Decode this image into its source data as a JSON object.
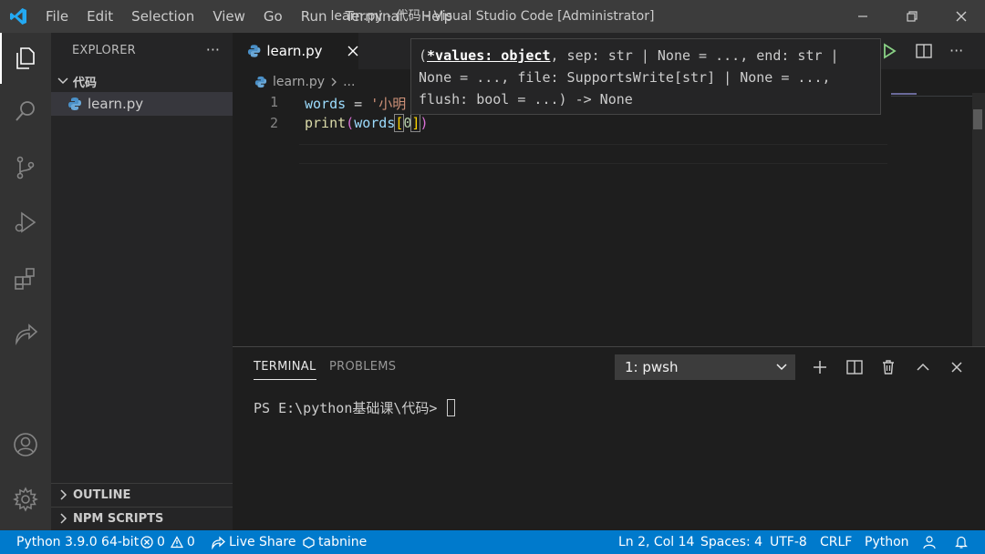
{
  "titlebar": {
    "menus": [
      "File",
      "Edit",
      "Selection",
      "View",
      "Go",
      "Run",
      "Terminal",
      "Help"
    ],
    "title": "learn.py - 代码 - Visual Studio Code [Administrator]"
  },
  "sidebar": {
    "header": "EXPLORER",
    "more": "···",
    "folder": "代码",
    "file": "learn.py",
    "outline": "OUTLINE",
    "npm_scripts": "NPM SCRIPTS"
  },
  "editor": {
    "tab_label": "learn.py",
    "breadcrumb_file": "learn.py",
    "breadcrumb_rest": "...",
    "line_numbers": [
      "1",
      "2"
    ],
    "line1": {
      "var": "words",
      "op": " = ",
      "str": "'小明"
    },
    "line2": {
      "func": "print",
      "open": "(",
      "var": "words",
      "bopen": "[",
      "num": "0",
      "bclose": "]",
      "close": ")"
    }
  },
  "tooltip": {
    "open": "(",
    "param_active": "*values: object",
    "rest1": ", sep: str | None = ..., end: str |",
    "line2": "None = ..., file: SupportsWrite[str] | None = ...,",
    "line3": "flush: bool = ...) -> None"
  },
  "panel": {
    "tab_terminal": "TERMINAL",
    "tab_problems": "PROBLEMS",
    "terminal_select": "1: pwsh",
    "prompt": "PS E:\\python基础课\\代码> "
  },
  "statusbar": {
    "interpreter": "Python 3.9.0 64-bit",
    "errors": "0",
    "warnings": "0",
    "live_share": "Live Share",
    "tabnine": "tabnine",
    "position": "Ln 2, Col 14",
    "spaces": "Spaces: 4",
    "encoding": "UTF-8",
    "eol": "CRLF",
    "language": "Python"
  },
  "colors": {
    "accent": "#007acc",
    "keyword_var": "#9cdcfe",
    "string": "#ce9178",
    "function": "#dcdcaa",
    "number": "#b5cea8",
    "run_icon": "#89d185"
  },
  "icons": [
    "vscode-logo-icon",
    "explorer-icon",
    "search-icon",
    "source-control-icon",
    "run-debug-icon",
    "extensions-icon",
    "live-share-icon",
    "account-icon",
    "gear-icon",
    "python-file-icon",
    "run-icon",
    "split-editor-icon"
  ]
}
